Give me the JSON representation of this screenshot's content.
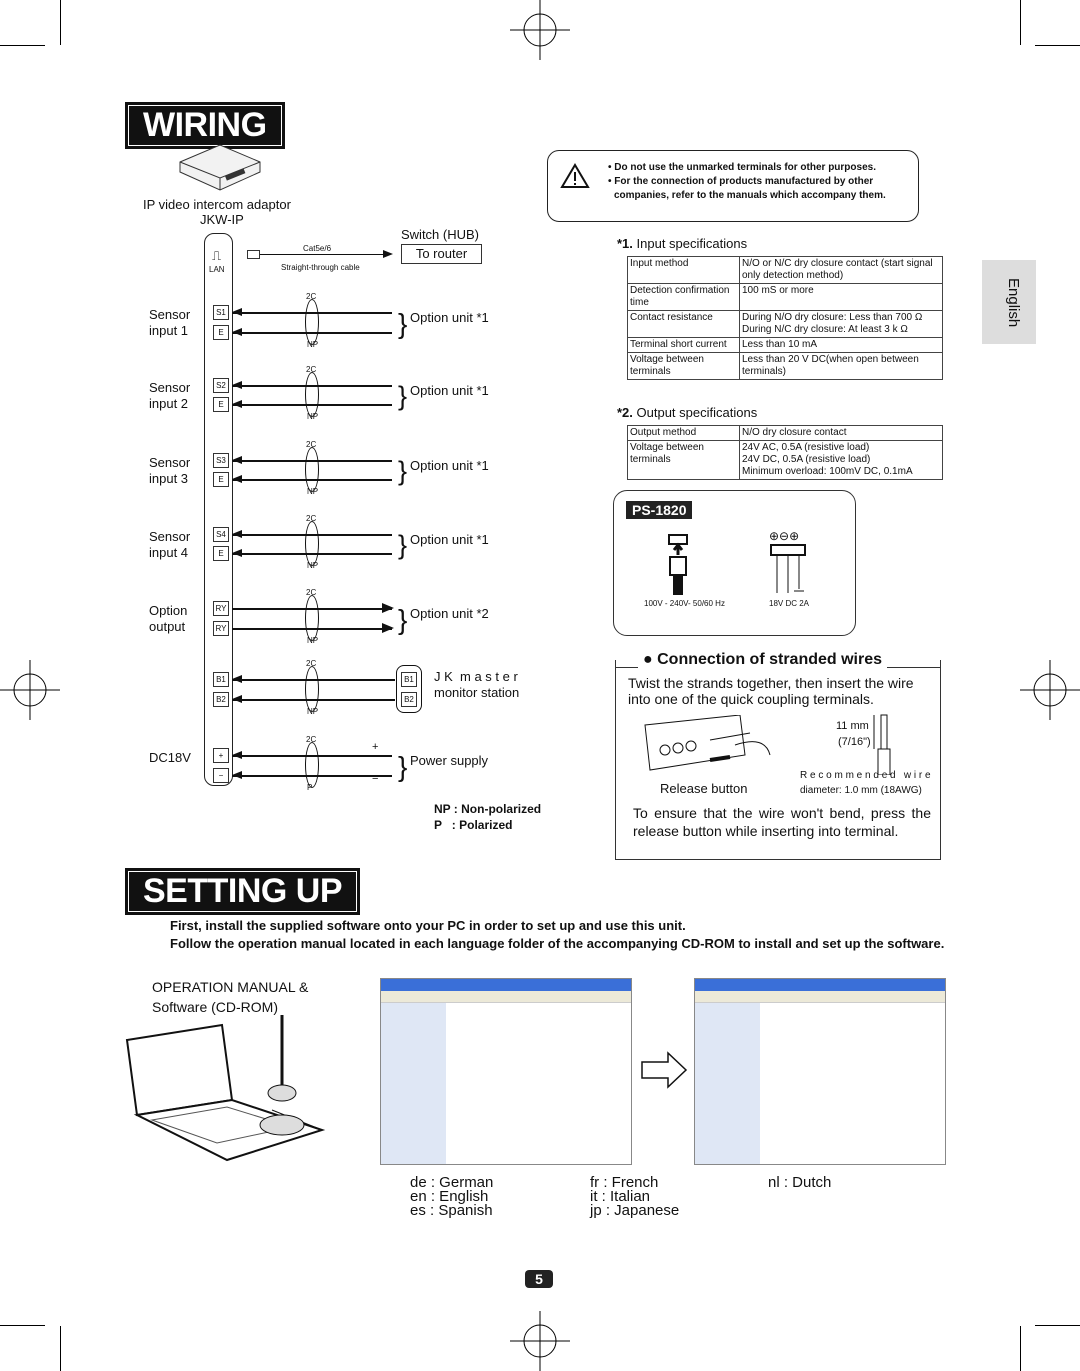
{
  "sections": {
    "wiring": "WIRING",
    "setting_up": "SETTING UP"
  },
  "caution": {
    "lines": [
      "• Do not use the unmarked terminals for other purposes.",
      "• For the connection of products manufactured by other companies, refer to the manuals which accompany them."
    ]
  },
  "language_tab": "English",
  "diagram": {
    "adaptor_label": "IP video intercom adaptor",
    "adaptor_model": "JKW-IP",
    "lan_label": "LAN",
    "cable_top": "Cat5e/6",
    "cable_bottom": "Straight-through cable",
    "hub_label": "Switch (HUB)",
    "router_label": "To router",
    "rows": [
      {
        "left": "Sensor\ninput 1",
        "t1": "S1",
        "t2": "E",
        "top": "2C",
        "bottom": "NP",
        "right": "Option unit *1"
      },
      {
        "left": "Sensor\ninput 2",
        "t1": "S2",
        "t2": "E",
        "top": "2C",
        "bottom": "NP",
        "right": "Option unit *1"
      },
      {
        "left": "Sensor\ninput 3",
        "t1": "S3",
        "t2": "E",
        "top": "2C",
        "bottom": "NP",
        "right": "Option unit *1"
      },
      {
        "left": "Sensor\ninput 4",
        "t1": "S4",
        "t2": "E",
        "top": "2C",
        "bottom": "NP",
        "right": "Option unit *1"
      },
      {
        "left": "Option\noutput",
        "t1": "RY",
        "t2": "RY",
        "top": "2C",
        "bottom": "NP",
        "right": "Option unit *2"
      },
      {
        "left": "",
        "t1": "B1",
        "t2": "B2",
        "top": "2C",
        "bottom": "NP",
        "right": "J K  m a s t e r\nmonitor station",
        "r1": "B1",
        "r2": "B2"
      },
      {
        "left": "DC18V",
        "t1": "+",
        "t2": "−",
        "top": "2C",
        "bottom": "P",
        "right": "Power supply",
        "p1": "+",
        "p2": "−"
      }
    ],
    "legend": [
      "NP : Non-polarized",
      "P   : Polarized"
    ]
  },
  "input_spec": {
    "title_num": "*1.",
    "title": " Input specifications",
    "rows": [
      [
        "Input method",
        "N/O or N/C dry closure contact (start signal only detection method)"
      ],
      [
        "Detection confirmation time",
        "100 mS or more"
      ],
      [
        "Contact resistance",
        "During N/O dry closure: Less than 700 Ω\nDuring N/C dry closure: At least 3 k Ω"
      ],
      [
        "Terminal short current",
        "Less than 10 mA"
      ],
      [
        "Voltage between terminals",
        "Less than 20 V DC(when open between terminals)"
      ]
    ]
  },
  "output_spec": {
    "title_num": "*2.",
    "title": " Output specifications",
    "rows": [
      [
        "Output method",
        "N/O dry closure contact"
      ],
      [
        "Voltage between terminals",
        "24V AC, 0.5A (resistive load)\n24V DC, 0.5A (resistive load)\nMinimum overload: 100mV DC, 0.1mA"
      ]
    ]
  },
  "ps": {
    "model": "PS-1820",
    "ac": "100V - 240V- 50/60 Hz",
    "dc": "18V DC 2A",
    "terminals": "⊕⊖⊕"
  },
  "stranded": {
    "title": "● Connection of stranded wires",
    "intro": "Twist the strands together, then insert the wire into one of the quick coupling terminals.",
    "length": "11 mm",
    "length_in": "(7/16\")",
    "release": "Release button",
    "rec1": "R e c o m m e n d e d   w i r e",
    "rec2": "diameter: 1.0 mm (18AWG)",
    "note": "To ensure that the wire won't bend, press the release button while inserting into terminal."
  },
  "setup": {
    "p1": "First, install the supplied software onto your PC in order to set up and use this unit.",
    "p2": "Follow the operation manual located in each language folder of the accompanying CD-ROM to install and set up the software.",
    "cd1": "OPERATION MANUAL &",
    "cd2": "Software (CD-ROM)"
  },
  "languages": [
    [
      "de",
      "German"
    ],
    [
      "en",
      "English"
    ],
    [
      "es",
      "Spanish"
    ],
    [
      "fr",
      "French"
    ],
    [
      "it",
      "Italian"
    ],
    [
      "jp",
      "Japanese"
    ],
    [
      "nl",
      "Dutch"
    ]
  ],
  "page_number": "5"
}
